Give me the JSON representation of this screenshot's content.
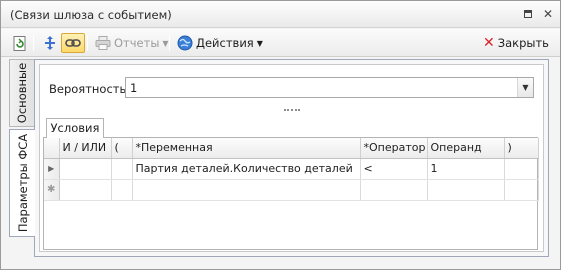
{
  "window": {
    "title": "(Связи шлюза с событием)",
    "restore_icon": "restore-icon",
    "close_icon": "close-icon"
  },
  "toolbar": {
    "reports_label": "Отчеты",
    "actions_label": "Действия",
    "close_label": "Закрыть"
  },
  "vertical_tabs": [
    "Основные",
    "Параметры ФСА"
  ],
  "form": {
    "probability_label": "Вероятность:",
    "probability_value": "1"
  },
  "subtab": "Условия",
  "grid": {
    "columns": [
      "И / ИЛИ",
      "(",
      "*Переменная",
      "*Оператор",
      "Операнд",
      ")"
    ],
    "rows": [
      {
        "and_or": "",
        "open": "",
        "variable": "Партия деталей.Количество деталей",
        "operator": "<",
        "operand": "1",
        "close": ""
      }
    ]
  }
}
